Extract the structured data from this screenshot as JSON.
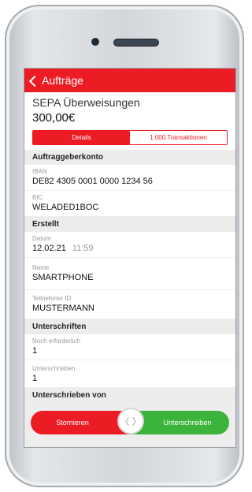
{
  "nav": {
    "back_label": "Aufträge"
  },
  "order": {
    "title": "SEPA Überweisungen",
    "amount": "300,00€"
  },
  "tabs": [
    {
      "label": "Details",
      "active": true
    },
    {
      "label": "1.000 Transaktionen",
      "active": false
    }
  ],
  "sections": {
    "auftraggeber": {
      "header": "Auftraggeberkonto",
      "iban_label": "IBAN",
      "iban_value": "DE82 4305 0001 0000 1234 56",
      "bic_label": "BIC",
      "bic_value": "WELADED1BOC"
    },
    "erstellt": {
      "header": "Erstellt",
      "datum_label": "Datum",
      "datum_value": "12.02.21",
      "zeit_value": "11:59",
      "name_label": "Name",
      "name_value": "SMARTPHONE",
      "teilnehmer_label": "Teilnehmer ID",
      "teilnehmer_value": "MUSTERMANN"
    },
    "unterschriften": {
      "header": "Unterschriften",
      "noch_label": "Noch erforderlich",
      "noch_value": "1",
      "unterschrieben_label": "Unterschrieben",
      "unterschrieben_value": "1"
    },
    "unterschrieben_von": {
      "header": "Unterschrieben von"
    }
  },
  "slider": {
    "left_label": "Stornieren",
    "right_label": "Unterschreiben",
    "knob_glyph": "〈 〉"
  },
  "colors": {
    "accent": "#ec1c24",
    "confirm": "#3cb43c"
  }
}
